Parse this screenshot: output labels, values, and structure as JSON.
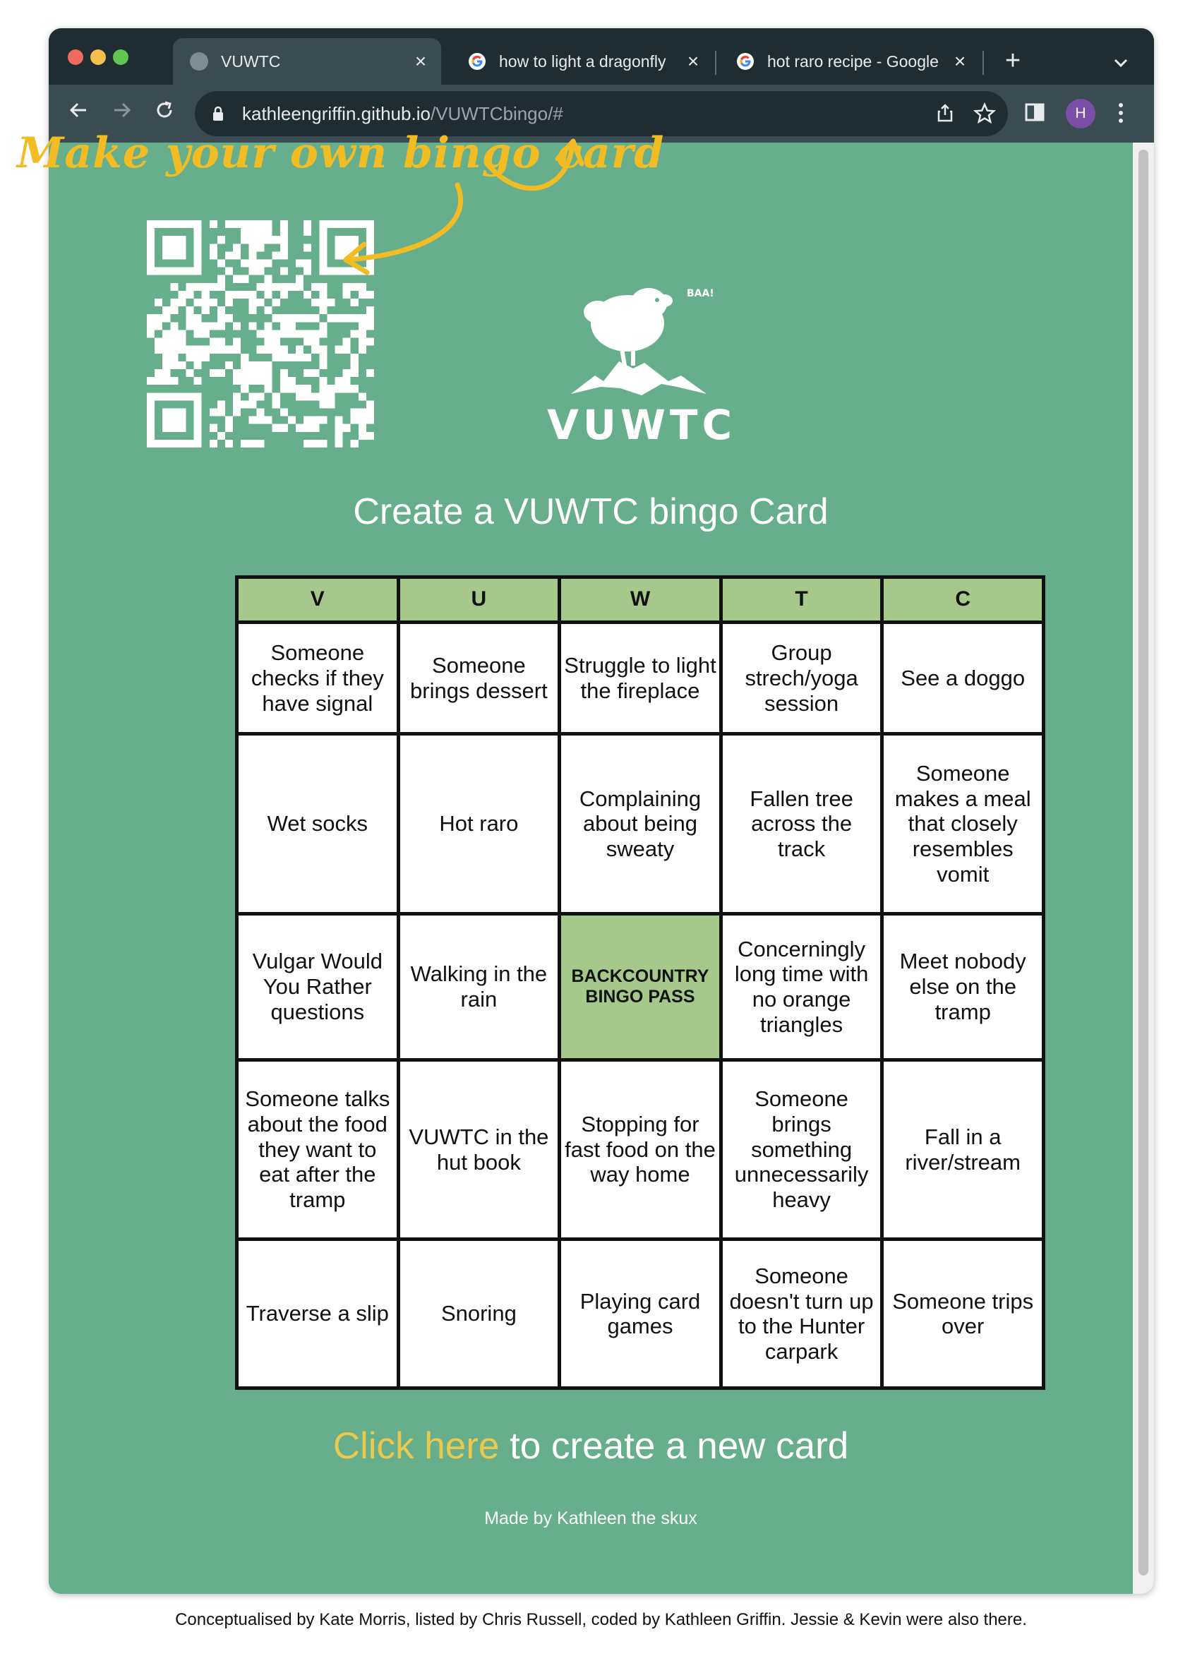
{
  "browser": {
    "tabs": [
      {
        "title": "VUWTC",
        "active": true,
        "icon": "globe-icon"
      },
      {
        "title": "how to light a dragonfly",
        "active": false,
        "icon": "google-icon"
      },
      {
        "title": "hot raro recipe - Google",
        "active": false,
        "icon": "google-icon"
      }
    ],
    "url_host": "kathleengriffin.github.io",
    "url_path": "/VUWTCbingo/#",
    "profile_initial": "H",
    "icons": {
      "back": "arrow-left-icon",
      "forward": "arrow-right-icon",
      "reload": "reload-icon",
      "lock": "lock-icon",
      "share": "share-icon",
      "bookmark": "star-icon",
      "sidepanel": "side-panel-icon",
      "menu": "kebab-menu-icon",
      "newtab": "plus-icon",
      "tabsearch": "chevron-down-icon"
    }
  },
  "annotation": {
    "text": "Make your own bingo card",
    "color": "#f2bd24"
  },
  "page": {
    "logo_text": "VUWTC",
    "logo_sound": "BAA!",
    "heading": "Create a VUWTC bingo Card",
    "bingo": {
      "columns": [
        "V",
        "U",
        "W",
        "T",
        "C"
      ],
      "rows": [
        [
          "Someone checks if they have signal",
          "Someone brings dessert",
          "Struggle to light the fireplace",
          "Group strech/yoga session",
          "See a doggo"
        ],
        [
          "Wet socks",
          "Hot raro",
          "Complaining about being sweaty",
          "Fallen tree across the track",
          "Someone makes a meal that closely resembles vomit"
        ],
        [
          "Vulgar Would You Rather questions",
          "Walking in the rain",
          "BACKCOUNTRY BINGO PASS",
          "Concerningly long time with no orange triangles",
          "Meet nobody else on the tramp"
        ],
        [
          "Someone talks about the food they want to eat after the tramp",
          "VUWTC in the hut book",
          "Stopping for fast food on the way home",
          "Someone brings something unnecessarily heavy",
          "Fall in a river/stream"
        ],
        [
          "Traverse a slip",
          "Snoring",
          "Playing card games",
          "Someone doesn't turn up to the Hunter carpark",
          "Someone trips over"
        ]
      ]
    },
    "cta_link": "Click here",
    "cta_rest": " to create a new card",
    "credit": "Made by Kathleen the skux"
  },
  "caption": "Conceptualised by Kate Morris, listed by Chris Russell, coded by Kathleen Griffin. Jessie & Kevin were also there.",
  "colors": {
    "page_bg": "#67ae8c",
    "bingo_header": "#a6c98b",
    "link": "#ebc94e",
    "chrome_dark": "#1f2d33",
    "chrome_toolbar": "#3a4b52"
  }
}
